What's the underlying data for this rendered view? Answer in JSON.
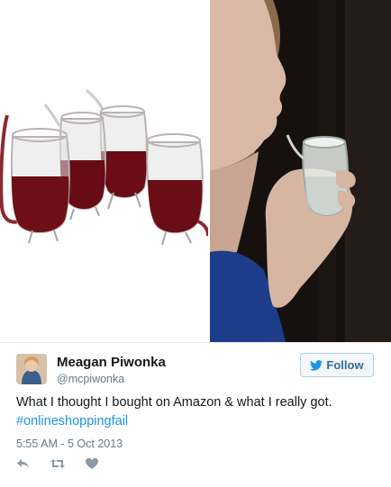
{
  "tweet": {
    "author_name": "Meagan Piwonka",
    "author_handle": "@mcpiwonka",
    "follow_label": "Follow",
    "text": "What I thought I bought on Amazon & what I really got.",
    "hashtag": "#onlineshoppingfail",
    "timestamp": "5:55 AM - 5 Oct 2013"
  },
  "icons": {
    "follow": "bird-icon",
    "reply": "reply-icon",
    "retweet": "retweet-icon",
    "like": "heart-icon"
  },
  "colors": {
    "link": "#1b95e0",
    "follow_text": "#2f6d99",
    "wine": "#6e0f17",
    "action_icon": "#8899a6"
  }
}
